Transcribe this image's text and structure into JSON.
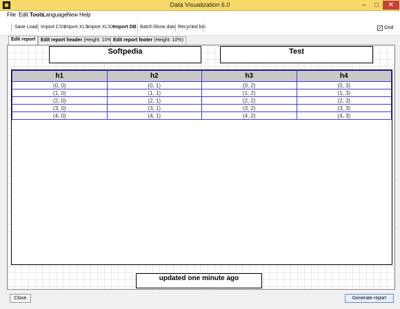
{
  "window": {
    "title": "Data Visualization 6.0"
  },
  "menu": [
    "File",
    "Edit",
    "Tools",
    "Language",
    "New",
    "Help"
  ],
  "toolbar": {
    "save": "Save",
    "load": "Load",
    "import_csv": "Import CSV",
    "import_xls": "Import XLS",
    "import_xlsx": "Import XLSX",
    "import_db": "Import DB",
    "batch": "Batch",
    "show_data": "Show data",
    "recycled_bin": "Recycled bin",
    "grid_label": "Grid",
    "grid_checked": true
  },
  "tabs": [
    {
      "label": "Edit report",
      "sub": ""
    },
    {
      "label": "Edit report header",
      "sub": "(Height: 10%)"
    },
    {
      "label": "Edit report footer",
      "sub": "(Height: 10%)"
    }
  ],
  "report": {
    "header_left": "Softpedia",
    "header_right": "Test",
    "columns": [
      "h1",
      "h2",
      "h3",
      "h4"
    ],
    "rows": [
      [
        "(0, 0)",
        "(0, 1)",
        "(0, 2)",
        "(0, 3)"
      ],
      [
        "(1, 0)",
        "(1, 1)",
        "(1, 2)",
        "(1, 3)"
      ],
      [
        "(2, 0)",
        "(2, 1)",
        "(2, 2)",
        "(2, 3)"
      ],
      [
        "(3, 0)",
        "(3, 1)",
        "(3, 2)",
        "(3, 3)"
      ],
      [
        "(4, 0)",
        "(4, 1)",
        "(4, 2)",
        "(4, 3)"
      ]
    ],
    "footer": "updated one minute ago"
  },
  "buttons": {
    "close": "Close",
    "generate": "Generate report"
  },
  "colors": {
    "titlebar": "#f7d96a",
    "table_border": "#3a3ad8",
    "header_fill": "#c8c8c8"
  }
}
